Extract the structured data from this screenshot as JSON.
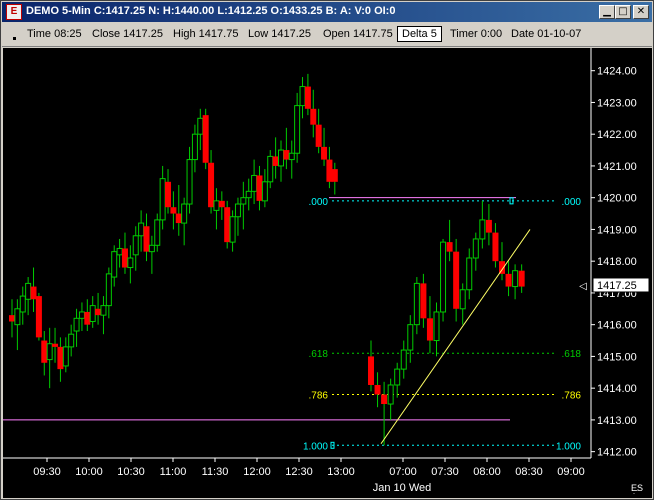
{
  "window": {
    "icon": "chart-app-icon",
    "title": "DEMO 5-Min C:1417.25 N: H:1440.00 L:1412.25 O:1433.25 B: A: V:0 OI:0",
    "buttons": [
      "minimize-icon",
      "maximize-icon",
      "close-icon"
    ]
  },
  "toolbar": {
    "time": "Time 08:25",
    "close": "Close 1417.25",
    "high": "High 1417.75",
    "low": "Low 1417.25",
    "open": "Open 1417.75",
    "delta": "Delta 5",
    "timer": "Timer 0:00",
    "date": "Date 01-10-07"
  },
  "colors": {
    "background": "#000000",
    "bull": "#00cc00",
    "bear": "#ff0000",
    "wick": "#00cc00",
    "fib_green": "#00cc00",
    "fib_yellow": "#ffff00",
    "fib_cyan": "#00ffff",
    "trendline": "#ffff66",
    "horizontal_line": "#ff80ff",
    "axis": "#ffffff"
  },
  "chart_data": {
    "type": "candlestick",
    "title": "",
    "xlabel": "Jan 10 Wed",
    "ylabel": "",
    "ylim": [
      1411.8,
      1424.4
    ],
    "y_ticks": [
      "1424.00",
      "1423.00",
      "1422.00",
      "1421.00",
      "1420.00",
      "1419.00",
      "1418.00",
      "1417.00",
      "1416.00",
      "1415.00",
      "1414.00",
      "1413.00",
      "1412.00"
    ],
    "x_ticks": [
      "09:30",
      "10:00",
      "10:30",
      "11:00",
      "11:30",
      "12:00",
      "12:30",
      "13:00",
      "07:00",
      "07:30",
      "08:00",
      "08:30",
      "09:00"
    ],
    "last_price": "1417.25",
    "symbol": "ES",
    "fib_levels": [
      {
        "label": ".000",
        "right_label": ".000",
        "price": 1419.9,
        "color": "cyan"
      },
      {
        "label": ".618",
        "right_label": ".618",
        "price": 1415.1,
        "color": "green"
      },
      {
        "label": ".786",
        "right_label": ".786",
        "price": 1413.8,
        "color": "yellow"
      },
      {
        "label": "1.000",
        "right_label": "1.000",
        "price": 1412.2,
        "color": "cyan"
      }
    ],
    "session_1": [
      [
        1416.3,
        1416.8,
        1415.6,
        1416.1
      ],
      [
        1416.0,
        1416.8,
        1415.2,
        1416.5
      ],
      [
        1416.4,
        1417.2,
        1416.0,
        1416.9
      ],
      [
        1416.8,
        1417.5,
        1416.3,
        1417.3
      ],
      [
        1417.2,
        1417.8,
        1416.4,
        1416.8
      ],
      [
        1416.9,
        1417.0,
        1415.5,
        1415.6
      ],
      [
        1415.5,
        1415.8,
        1414.4,
        1414.8
      ],
      [
        1414.9,
        1415.9,
        1414.0,
        1415.4
      ],
      [
        1415.4,
        1415.9,
        1414.8,
        1415.3
      ],
      [
        1415.3,
        1415.6,
        1414.2,
        1414.6
      ],
      [
        1414.7,
        1415.6,
        1414.5,
        1415.3
      ],
      [
        1415.3,
        1416.0,
        1415.0,
        1415.7
      ],
      [
        1415.8,
        1416.5,
        1415.3,
        1416.2
      ],
      [
        1416.2,
        1416.7,
        1415.8,
        1416.4
      ],
      [
        1416.4,
        1416.8,
        1415.8,
        1416.0
      ],
      [
        1416.1,
        1416.9,
        1415.9,
        1416.6
      ],
      [
        1416.5,
        1417.0,
        1416.0,
        1416.3
      ],
      [
        1416.3,
        1416.9,
        1415.7,
        1416.6
      ],
      [
        1416.6,
        1417.8,
        1416.2,
        1417.6
      ],
      [
        1417.5,
        1418.5,
        1417.2,
        1418.3
      ],
      [
        1418.2,
        1418.7,
        1417.8,
        1418.4
      ],
      [
        1418.4,
        1418.9,
        1417.6,
        1417.8
      ],
      [
        1417.8,
        1418.5,
        1417.3,
        1418.1
      ],
      [
        1418.2,
        1419.1,
        1417.7,
        1418.8
      ],
      [
        1418.8,
        1419.6,
        1418.3,
        1419.2
      ],
      [
        1419.1,
        1419.5,
        1418.0,
        1418.3
      ],
      [
        1418.3,
        1418.8,
        1417.6,
        1418.5
      ],
      [
        1418.5,
        1419.5,
        1418.3,
        1419.3
      ],
      [
        1419.3,
        1421.0,
        1419.0,
        1420.6
      ],
      [
        1420.5,
        1420.9,
        1419.5,
        1419.7
      ],
      [
        1419.7,
        1420.2,
        1419.0,
        1419.5
      ],
      [
        1419.5,
        1420.4,
        1418.8,
        1419.2
      ],
      [
        1419.2,
        1420.0,
        1418.5,
        1419.8
      ],
      [
        1419.8,
        1421.6,
        1419.5,
        1421.2
      ],
      [
        1421.2,
        1422.3,
        1420.8,
        1422.0
      ],
      [
        1422.0,
        1422.8,
        1421.5,
        1422.5
      ],
      [
        1422.6,
        1422.8,
        1420.9,
        1421.1
      ],
      [
        1421.1,
        1421.5,
        1419.5,
        1419.7
      ],
      [
        1419.6,
        1420.3,
        1419.0,
        1419.9
      ],
      [
        1419.9,
        1420.2,
        1419.3,
        1419.7
      ],
      [
        1419.7,
        1419.9,
        1418.4,
        1418.6
      ],
      [
        1418.6,
        1419.6,
        1418.3,
        1419.4
      ],
      [
        1419.4,
        1420.0,
        1418.8,
        1419.8
      ],
      [
        1419.8,
        1420.5,
        1419.0,
        1420.0
      ],
      [
        1420.0,
        1420.6,
        1419.6,
        1420.2
      ],
      [
        1420.2,
        1421.2,
        1419.8,
        1420.7
      ],
      [
        1420.7,
        1421.0,
        1419.6,
        1419.9
      ],
      [
        1419.9,
        1420.9,
        1419.7,
        1420.5
      ],
      [
        1420.5,
        1421.5,
        1420.3,
        1421.3
      ],
      [
        1421.3,
        1421.9,
        1420.6,
        1421.0
      ],
      [
        1421.0,
        1421.8,
        1420.5,
        1421.5
      ],
      [
        1421.5,
        1422.2,
        1420.9,
        1421.2
      ],
      [
        1421.2,
        1421.8,
        1420.6,
        1421.4
      ],
      [
        1421.4,
        1423.3,
        1421.1,
        1422.9
      ],
      [
        1422.9,
        1423.8,
        1422.5,
        1423.5
      ],
      [
        1423.5,
        1423.9,
        1422.6,
        1422.8
      ],
      [
        1422.8,
        1423.4,
        1421.9,
        1422.3
      ],
      [
        1422.3,
        1422.8,
        1421.4,
        1421.6
      ],
      [
        1421.6,
        1422.2,
        1421.0,
        1421.2
      ],
      [
        1421.2,
        1421.6,
        1420.3,
        1420.5
      ],
      [
        1420.9,
        1421.1,
        1420.1,
        1420.5
      ]
    ],
    "session_2": [
      [
        1415.0,
        1415.5,
        1413.9,
        1414.1
      ],
      [
        1414.1,
        1414.5,
        1413.4,
        1413.8
      ],
      [
        1413.8,
        1414.2,
        1412.2,
        1413.5
      ],
      [
        1413.5,
        1414.3,
        1413.0,
        1414.1
      ],
      [
        1414.1,
        1414.8,
        1413.7,
        1414.6
      ],
      [
        1414.6,
        1415.5,
        1414.3,
        1415.2
      ],
      [
        1415.2,
        1416.3,
        1414.8,
        1416.0
      ],
      [
        1416.0,
        1417.5,
        1415.7,
        1417.3
      ],
      [
        1417.3,
        1417.6,
        1415.9,
        1416.2
      ],
      [
        1416.2,
        1416.9,
        1415.1,
        1415.5
      ],
      [
        1415.5,
        1416.7,
        1415.0,
        1416.4
      ],
      [
        1416.4,
        1418.7,
        1416.1,
        1418.6
      ],
      [
        1418.6,
        1419.3,
        1418.0,
        1418.3
      ],
      [
        1418.3,
        1418.7,
        1416.1,
        1416.5
      ],
      [
        1416.5,
        1417.3,
        1416.0,
        1417.1
      ],
      [
        1417.1,
        1418.4,
        1416.8,
        1418.1
      ],
      [
        1418.1,
        1418.9,
        1417.7,
        1418.7
      ],
      [
        1418.7,
        1419.9,
        1418.4,
        1419.3
      ],
      [
        1419.3,
        1419.8,
        1418.5,
        1418.9
      ],
      [
        1418.9,
        1419.2,
        1417.8,
        1418.0
      ],
      [
        1418.0,
        1418.6,
        1417.4,
        1417.6
      ],
      [
        1417.6,
        1418.0,
        1416.9,
        1417.2
      ],
      [
        1417.2,
        1417.9,
        1416.8,
        1417.7
      ],
      [
        1417.7,
        1417.9,
        1417.0,
        1417.2
      ]
    ]
  }
}
